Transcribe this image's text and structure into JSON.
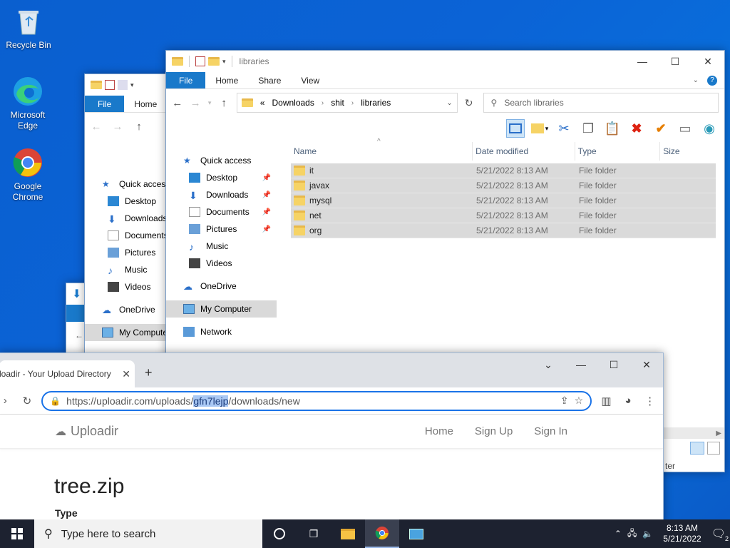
{
  "desktop": {
    "icons": [
      {
        "label": "Recycle Bin"
      },
      {
        "label": "Microsoft Edge"
      },
      {
        "label": "Google Chrome"
      }
    ]
  },
  "explorer_back": {
    "tabs": {
      "file": "File",
      "home": "Home"
    },
    "nav": [
      "Quick access",
      "Desktop",
      "Downloads",
      "Documents",
      "Pictures",
      "Music",
      "Videos",
      "OneDrive",
      "My Computer"
    ]
  },
  "explorer": {
    "title": "libraries",
    "tabs": {
      "file": "File",
      "home": "Home",
      "share": "Share",
      "view": "View"
    },
    "breadcrumb": {
      "prefix": "«",
      "items": [
        "Downloads",
        "shit",
        "libraries"
      ]
    },
    "search_placeholder": "Search libraries",
    "nav": {
      "quick_access": "Quick access",
      "desktop": "Desktop",
      "downloads": "Downloads",
      "documents": "Documents",
      "pictures": "Pictures",
      "music": "Music",
      "videos": "Videos",
      "onedrive": "OneDrive",
      "my_computer": "My Computer",
      "network": "Network"
    },
    "columns": {
      "name": "Name",
      "date": "Date modified",
      "type": "Type",
      "size": "Size"
    },
    "files": [
      {
        "name": "it",
        "date": "5/21/2022 8:13 AM",
        "type": "File folder"
      },
      {
        "name": "javax",
        "date": "5/21/2022 8:13 AM",
        "type": "File folder"
      },
      {
        "name": "mysql",
        "date": "5/21/2022 8:13 AM",
        "type": "File folder"
      },
      {
        "name": "net",
        "date": "5/21/2022 8:13 AM",
        "type": "File folder"
      },
      {
        "name": "org",
        "date": "5/21/2022 8:13 AM",
        "type": "File folder"
      }
    ],
    "status_fragment": "ter"
  },
  "chrome": {
    "tab_title": "Uploadir - Your Upload Directory",
    "tab_title_visible": "loadir - Your Upload Directory",
    "url_prefix": "https://uploadir.com/uploads/",
    "url_highlight": "gfn7lejp",
    "url_suffix": "/downloads/new",
    "site": {
      "logo": "Uploadir",
      "links": {
        "home": "Home",
        "signup": "Sign Up",
        "signin": "Sign In"
      },
      "title": "tree.zip",
      "subheading": "Type"
    }
  },
  "taskbar": {
    "search_placeholder": "Type here to search",
    "time": "8:13 AM",
    "date": "5/21/2022",
    "notification_count": "2"
  }
}
